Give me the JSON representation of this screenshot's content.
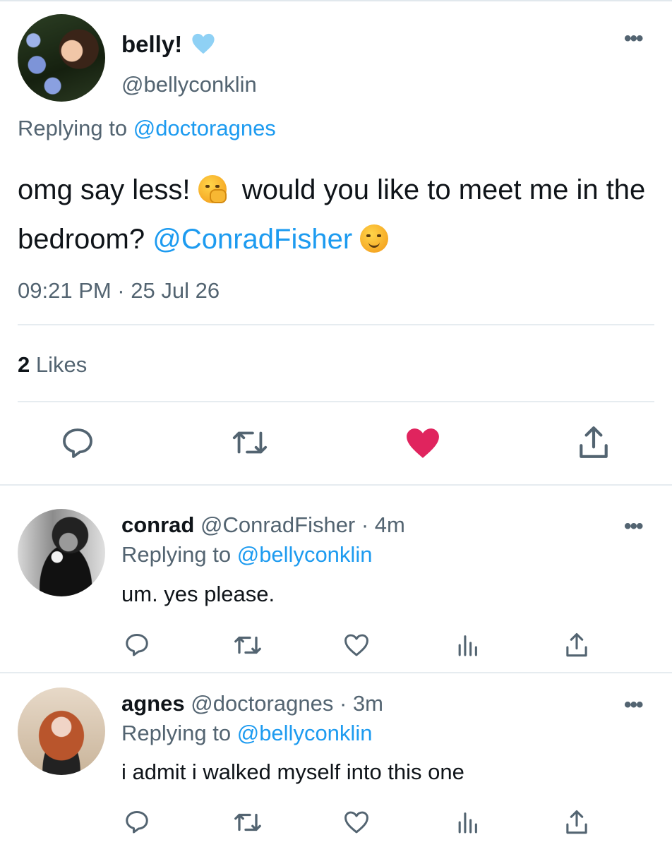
{
  "main_tweet": {
    "display_name": "belly!",
    "handle": "@bellyconklin",
    "replying_label": "Replying to",
    "replying_to": "@doctoragnes",
    "text_part1": "omg say less!",
    "text_part2": "would you like to meet me in the bedroom?",
    "text_mention": "@ConradFisher",
    "timestamp": "09:21 PM · 25 Jul 26",
    "likes_count": "2",
    "likes_label": "Likes",
    "liked": true,
    "colors": {
      "accent": "#1d9bf0",
      "like": "#f91880",
      "secondary_text": "#536471"
    }
  },
  "replies": [
    {
      "display_name": "conrad",
      "meta": "@ConradFisher · 4m",
      "replying_label": "Replying to",
      "replying_to": "@bellyconklin",
      "text": "um. yes please."
    },
    {
      "display_name": "agnes",
      "meta": "@doctoragnes · 3m",
      "replying_label": "Replying to",
      "replying_to": "@bellyconklin",
      "text": "i admit i walked myself into this one"
    }
  ],
  "icons": {
    "more": "more-icon",
    "reply": "reply-icon",
    "retweet": "retweet-icon",
    "like": "like-icon",
    "share": "share-icon",
    "analytics": "analytics-icon",
    "badge": "blue-heart-icon"
  },
  "glyphs": {
    "more": "•••"
  }
}
